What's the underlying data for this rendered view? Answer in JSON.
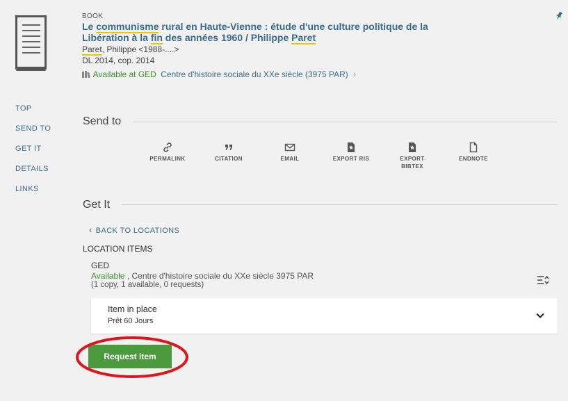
{
  "record": {
    "type": "BOOK",
    "title_pre": "Le ",
    "title_hl1": "communisme",
    "title_mid": " rural en Haute-Vienne : étude d'une culture politique de la Libération à la ",
    "title_hl2": "fin",
    "title_mid2": " des années 1960 / Philippe ",
    "title_hl3": "Paret",
    "author_hl": "Paret",
    "author_rest": ", Philippe <1988-....>",
    "date": "DL 2014, cop. 2014",
    "availability_status": "Available at GED",
    "availability_location": "Centre d'histoire sociale du XXe siècle (3975 PAR)"
  },
  "nav": {
    "top": "TOP",
    "send_to": "SEND TO",
    "get_it": "GET IT",
    "details": "DETAILS",
    "links": "LINKS"
  },
  "send_to": {
    "title": "Send to",
    "actions": {
      "permalink": "PERMALINK",
      "citation": "CITATION",
      "email": "EMAIL",
      "export_ris": "EXPORT RIS",
      "export_bibtex_1": "EXPORT",
      "export_bibtex_2": "BIBTEX",
      "endnote": "ENDNOTE"
    }
  },
  "get_it": {
    "title": "Get It",
    "back_label": "BACK TO LOCATIONS",
    "location_items_label": "LOCATION ITEMS",
    "library": "GED",
    "status": "Available",
    "location_rest": " , Centre d'histoire sociale du XXe siècle 3975 PAR",
    "counts": "(1 copy, 1 available, 0 requests)",
    "item_status": "Item in place",
    "item_policy": "Prêt 60 Jours",
    "request_button": "Request item"
  },
  "colors": {
    "link_blue": "#3a6b8e",
    "available_green": "#3d8f2e",
    "button_green": "#4b9b3e",
    "highlight_yellow": "#e8c600",
    "annotation_red": "#e0141e"
  }
}
